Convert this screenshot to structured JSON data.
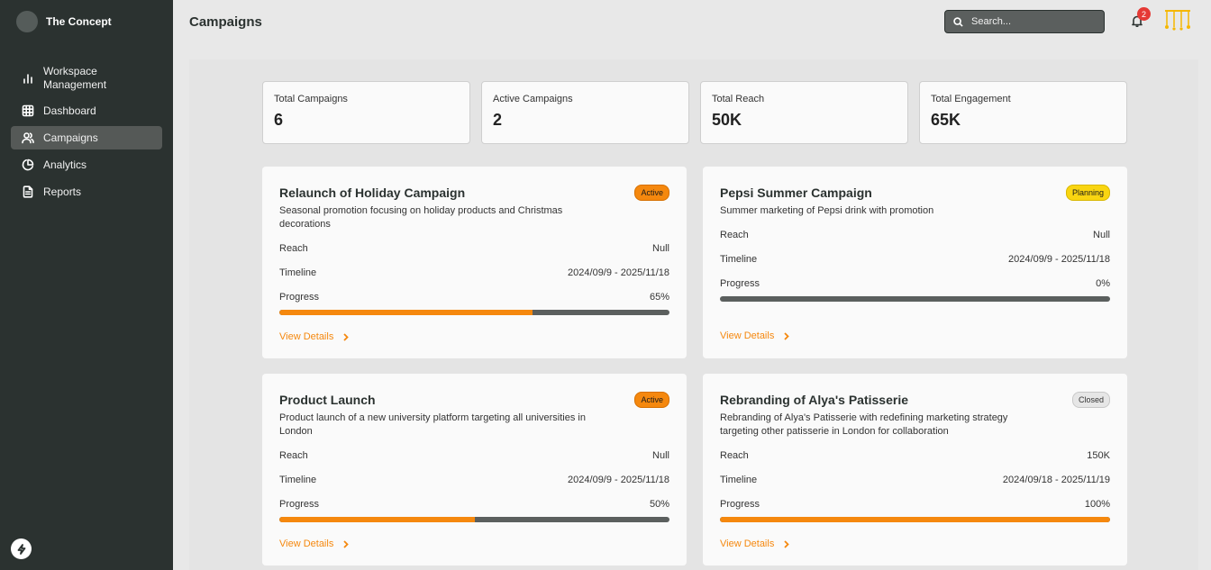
{
  "app": {
    "name": "The Concept"
  },
  "sidebar": {
    "items": [
      {
        "label": "Workspace\nManagement",
        "icon": "bar-chart-icon"
      },
      {
        "label": "Dashboard",
        "icon": "grid-icon"
      },
      {
        "label": "Campaigns",
        "icon": "users-icon",
        "active": true
      },
      {
        "label": "Analytics",
        "icon": "pie-chart-icon"
      },
      {
        "label": "Reports",
        "icon": "document-icon"
      }
    ]
  },
  "header": {
    "title": "Campaigns",
    "search_placeholder": "Search...",
    "notification_count": "2"
  },
  "stats": [
    {
      "label": "Total Campaigns",
      "value": "6"
    },
    {
      "label": "Active Campaigns",
      "value": "2"
    },
    {
      "label": "Total Reach",
      "value": "50K"
    },
    {
      "label": "Total Engagement",
      "value": "65K"
    }
  ],
  "campaigns": [
    {
      "title": "Relaunch of Holiday Campaign",
      "status": "Active",
      "description": "Seasonal promotion focusing on holiday products and Christmas decorations",
      "reach_label": "Reach",
      "reach": "Null",
      "timeline_label": "Timeline",
      "timeline": "2024/09/9 - 2025/11/18",
      "progress_label": "Progress",
      "progress": "65%",
      "details_label": "View Details"
    },
    {
      "title": "Pepsi Summer Campaign",
      "status": "Planning",
      "description": "Summer marketing of Pepsi drink with promotion",
      "reach_label": "Reach",
      "reach": "Null",
      "timeline_label": "Timeline",
      "timeline": "2024/09/9 - 2025/11/18",
      "progress_label": "Progress",
      "progress": "0%",
      "details_label": "View Details"
    },
    {
      "title": "Product Launch",
      "status": "Active",
      "description": "Product launch of a new university platform targeting all universities in London",
      "reach_label": "Reach",
      "reach": "Null",
      "timeline_label": "Timeline",
      "timeline": "2024/09/9 - 2025/11/18",
      "progress_label": "Progress",
      "progress": "50%",
      "details_label": "View Details"
    },
    {
      "title": "Rebranding of Alya's Patisserie",
      "status": "Closed",
      "description": "Rebranding of Alya's Patisserie with redefining marketing strategy targeting other patisserie in London for collaboration",
      "reach_label": "Reach",
      "reach": "150K",
      "timeline_label": "Timeline",
      "timeline": "2024/09/18 - 2025/11/19",
      "progress_label": "Progress",
      "progress": "100%",
      "details_label": "View Details"
    }
  ],
  "colors": {
    "sidebar_bg": "#2b3230",
    "accent": "#f5880e",
    "planning": "#f9d511",
    "badge": "#e53935"
  }
}
